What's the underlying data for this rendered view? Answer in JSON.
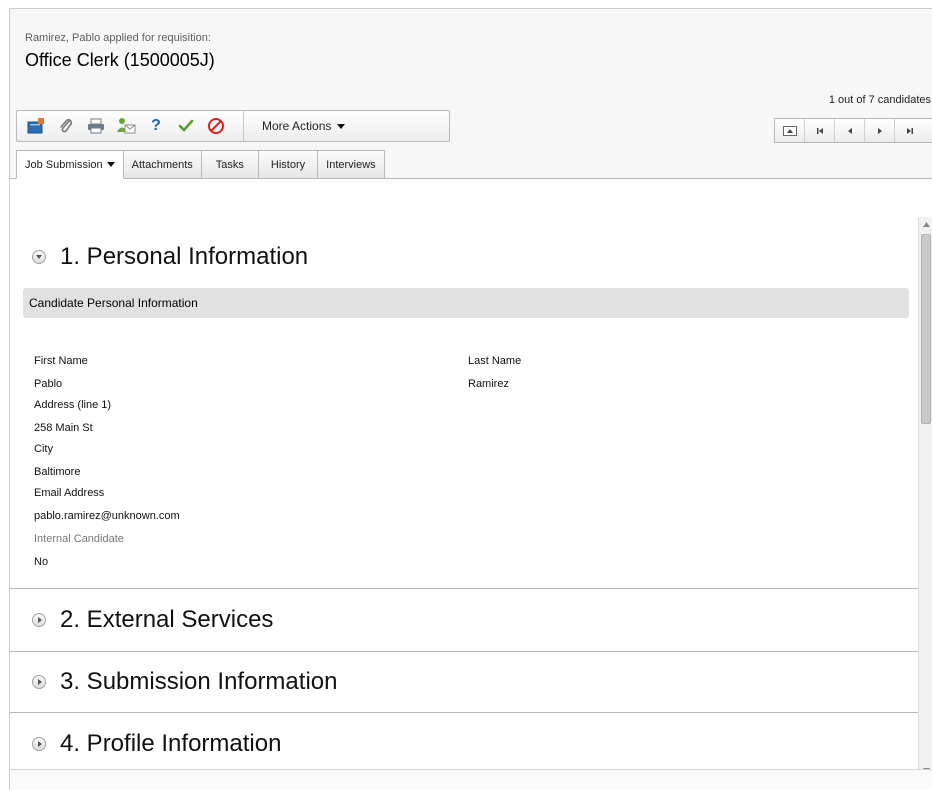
{
  "header": {
    "subtitle": "Ramirez, Pablo applied for requisition:",
    "title": "Office Clerk (1500005J)",
    "candidate_counter": "1 out of 7 candidates"
  },
  "toolbar": {
    "icons": [
      "new-icon",
      "attach-icon",
      "print-icon",
      "contact-icon",
      "help-icon",
      "approve-icon",
      "reject-icon"
    ],
    "help_glyph": "?",
    "more_actions_label": "More Actions"
  },
  "navigation": {
    "icons": [
      "collapse-icon",
      "first-icon",
      "previous-icon",
      "next-icon",
      "last-icon"
    ]
  },
  "tabs": [
    {
      "label": "Job Submission"
    },
    {
      "label": "Attachments"
    },
    {
      "label": "Tasks"
    },
    {
      "label": "History"
    },
    {
      "label": "Interviews"
    }
  ],
  "sections": [
    {
      "title": "1. Personal Information",
      "subsection_title": "Candidate Personal Information",
      "fields": {
        "first_name_label": "First Name",
        "first_name_value": "Pablo",
        "last_name_label": "Last Name",
        "last_name_value": "Ramirez",
        "address_label": "Address (line 1)",
        "address_value": "258 Main St",
        "city_label": "City",
        "city_value": "Baltimore",
        "email_label": "Email Address",
        "email_value": "pablo.ramirez@unknown.com",
        "internal_label": "Internal Candidate",
        "internal_value": "No"
      }
    },
    {
      "title": "2. External Services"
    },
    {
      "title": "3. Submission Information"
    },
    {
      "title": "4. Profile Information"
    }
  ],
  "colors": {
    "approve": "#5aa02c",
    "reject": "#d8231f",
    "help": "#1a63b8",
    "new_icon": "#2f6db3",
    "new_icon_badge": "#e8762d"
  }
}
